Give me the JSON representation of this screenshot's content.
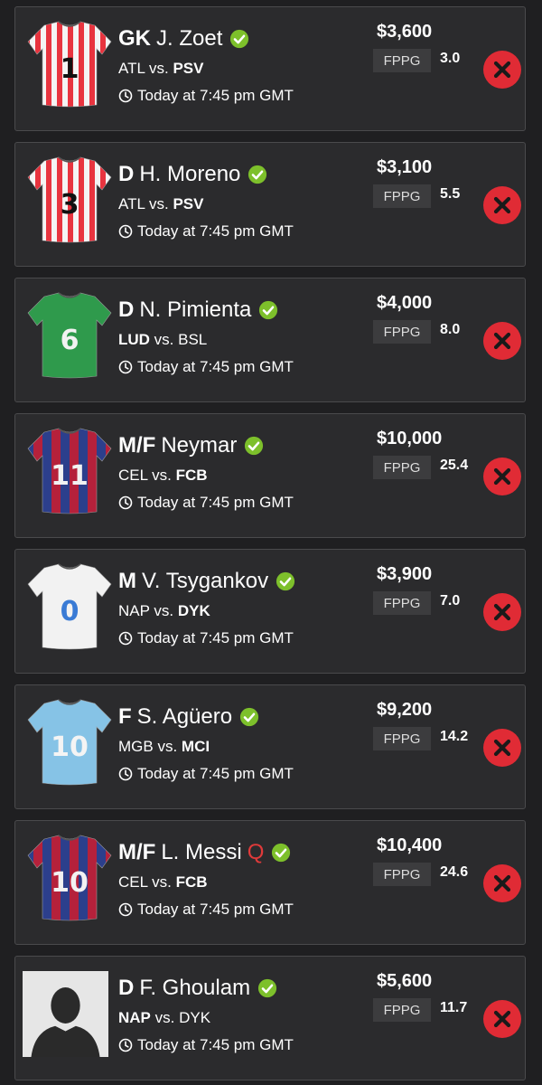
{
  "colors": {
    "background": "#1f1f21",
    "card": "#2b2b2d",
    "check": "#7dc02b",
    "remove": "#e02b35",
    "questionable": "#e03a3a"
  },
  "fppg_label": "FPPG",
  "players": [
    {
      "position": "GK",
      "name": "J. Zoet",
      "status": "",
      "team_left": "ATL",
      "vs": "vs.",
      "team_right": "PSV",
      "bold_side": "right",
      "time": "Today at 7:45 pm GMT",
      "salary": "$3,600",
      "fppg": "3.0",
      "jersey_number": "1",
      "jersey_style": "red-white-stripes"
    },
    {
      "position": "D",
      "name": "H. Moreno",
      "status": "",
      "team_left": "ATL",
      "vs": "vs.",
      "team_right": "PSV",
      "bold_side": "right",
      "time": "Today at 7:45 pm GMT",
      "salary": "$3,100",
      "fppg": "5.5",
      "jersey_number": "3",
      "jersey_style": "red-white-stripes"
    },
    {
      "position": "D",
      "name": "N. Pimienta",
      "status": "",
      "team_left": "LUD",
      "vs": "vs.",
      "team_right": "BSL",
      "bold_side": "left",
      "time": "Today at 7:45 pm GMT",
      "salary": "$4,000",
      "fppg": "8.0",
      "jersey_number": "6",
      "jersey_style": "green"
    },
    {
      "position": "M/F",
      "name": "Neymar",
      "status": "",
      "team_left": "CEL",
      "vs": "vs.",
      "team_right": "FCB",
      "bold_side": "right",
      "time": "Today at 7:45 pm GMT",
      "salary": "$10,000",
      "fppg": "25.4",
      "jersey_number": "11",
      "jersey_style": "blue-red-stripes"
    },
    {
      "position": "M",
      "name": "V. Tsygankov",
      "status": "",
      "team_left": "NAP",
      "vs": "vs.",
      "team_right": "DYK",
      "bold_side": "right",
      "time": "Today at 7:45 pm GMT",
      "salary": "$3,900",
      "fppg": "7.0",
      "jersey_number": "0",
      "jersey_style": "white"
    },
    {
      "position": "F",
      "name": "S. Agüero",
      "status": "",
      "team_left": "MGB",
      "vs": "vs.",
      "team_right": "MCI",
      "bold_side": "right",
      "time": "Today at 7:45 pm GMT",
      "salary": "$9,200",
      "fppg": "14.2",
      "jersey_number": "10",
      "jersey_style": "sky-blue"
    },
    {
      "position": "M/F",
      "name": "L. Messi",
      "status": "Q",
      "team_left": "CEL",
      "vs": "vs.",
      "team_right": "FCB",
      "bold_side": "right",
      "time": "Today at 7:45 pm GMT",
      "salary": "$10,400",
      "fppg": "24.6",
      "jersey_number": "10",
      "jersey_style": "blue-red-stripes"
    },
    {
      "position": "D",
      "name": "F. Ghoulam",
      "status": "",
      "team_left": "NAP",
      "vs": "vs.",
      "team_right": "DYK",
      "bold_side": "left",
      "time": "Today at 7:45 pm GMT",
      "salary": "$5,600",
      "fppg": "11.7",
      "jersey_number": "",
      "jersey_style": "silhouette"
    }
  ]
}
